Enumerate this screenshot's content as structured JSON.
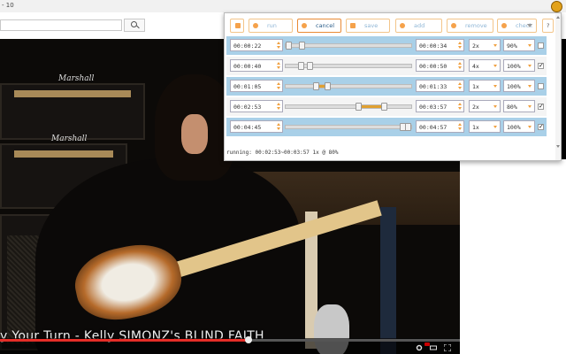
{
  "browser": {
    "tab_title": "- 10",
    "extension_icon": "clock-icon"
  },
  "video": {
    "caption": "y Your Turn - Kelly SIMONZ's BLIND FAITH",
    "progress": 0.54,
    "amp_brand": "Marshall"
  },
  "toolbar": {
    "close_label": "",
    "run_label": "run",
    "cancel_label": "cancel",
    "save_label": "save",
    "add_label": "add",
    "remove_label": "remove",
    "check_label": "check",
    "help_label": "?"
  },
  "rows": [
    {
      "start": "00:00:22",
      "end": "00:00:34",
      "speed": "2x",
      "volume": "90%",
      "range": [
        0.0,
        0.13
      ],
      "checked": false
    },
    {
      "start": "00:00:40",
      "end": "00:00:50",
      "speed": "4x",
      "volume": "100%",
      "range": [
        0.12,
        0.19
      ],
      "checked": true
    },
    {
      "start": "00:01:05",
      "end": "00:01:33",
      "speed": "1x",
      "volume": "100%",
      "range": [
        0.24,
        0.33
      ],
      "checked": false
    },
    {
      "start": "00:02:53",
      "end": "00:03:57",
      "speed": "2x",
      "volume": "80%",
      "range": [
        0.58,
        0.78
      ],
      "checked": true
    },
    {
      "start": "00:04:45",
      "end": "00:04:57",
      "speed": "1x",
      "volume": "100%",
      "range": [
        0.93,
        1.0
      ],
      "checked": true
    }
  ],
  "status": "running: 00:02:53~00:03:57 1x @ 80%",
  "colors": {
    "accent": "#f5a24b",
    "row_highlight": "#a9d0e8",
    "range": "#e0a030",
    "progress": "#e52d27"
  }
}
